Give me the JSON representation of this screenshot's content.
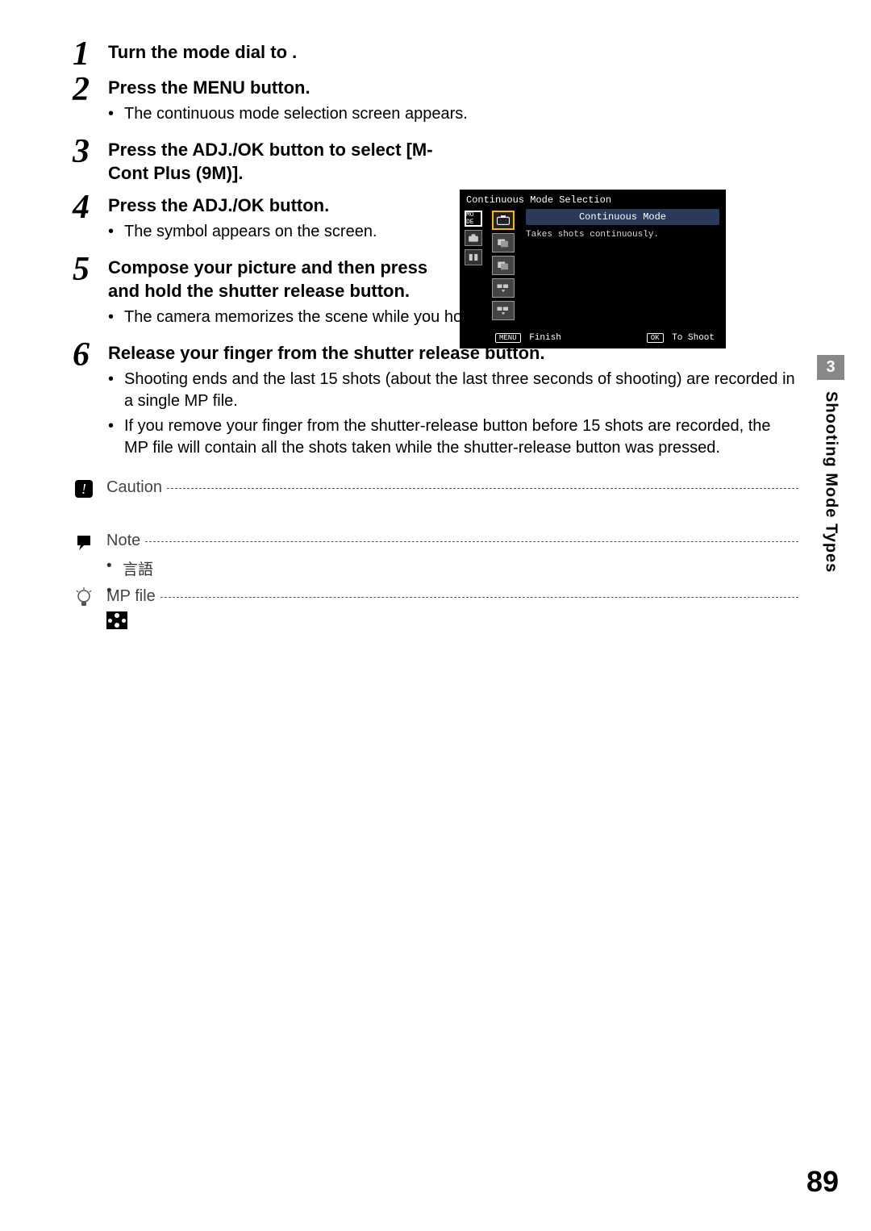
{
  "side": {
    "chapter_num": "3",
    "chapter_title": "Shooting Mode Types"
  },
  "page_number": "89",
  "steps": [
    {
      "num": "1",
      "title": "Turn the mode dial to    .",
      "subs": []
    },
    {
      "num": "2",
      "title": "Press the MENU button.",
      "subs": [
        "The continuous mode selection screen appears."
      ]
    },
    {
      "num": "3",
      "title": "Press the ADJ./OK button to select [M-Cont Plus (9M)].",
      "subs": []
    },
    {
      "num": "4",
      "title": "Press the ADJ./OK button.",
      "subs": [
        "The symbol appears on the screen."
      ]
    },
    {
      "num": "5",
      "title": "Compose your picture and then press and hold the shutter release button.",
      "subs": [
        "The camera memorizes the scene while you hold down the shutter release button."
      ]
    },
    {
      "num": "6",
      "title": "Release your finger from the shutter release button.",
      "subs": [
        "Shooting ends and the last 15 shots (about the last three seconds of shooting) are recorded in a single MP file.",
        "If you remove your finger from the shutter-release button before 15 shots are recorded, the MP file will contain all the shots taken while the shutter-release button was pressed."
      ]
    }
  ],
  "callouts": {
    "caution_label": "Caution",
    "note_label": "Note",
    "note_items": [
      "言語",
      ""
    ],
    "mpfile_label": "MP file"
  },
  "camera": {
    "header": "Continuous Mode Selection",
    "mode_title": "Continuous Mode",
    "mode_desc": "Takes shots continuously.",
    "left_labels": [
      "MO DE",
      "",
      ""
    ],
    "footer_menu_btn": "MENU",
    "footer_menu_label": "Finish",
    "footer_ok_btn": "OK",
    "footer_ok_label": "To Shoot"
  }
}
